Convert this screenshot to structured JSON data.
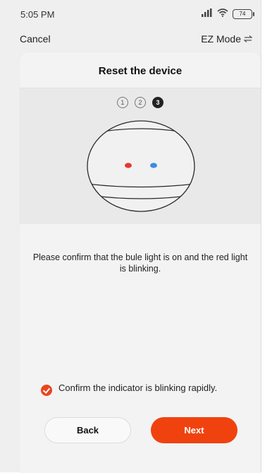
{
  "status_bar": {
    "time": "5:05 PM",
    "battery": "74"
  },
  "nav": {
    "cancel_label": "Cancel",
    "mode_label": "EZ Mode",
    "mode_icon": "swap-arrows-icon"
  },
  "card": {
    "title": "Reset the device"
  },
  "steps": {
    "items": [
      "1",
      "2",
      "3"
    ],
    "active": 3
  },
  "instruction": "Please confirm that the bule light is on and the red light is blinking.",
  "confirm": {
    "label": "Confirm the indicator is blinking rapidly.",
    "checked": true
  },
  "buttons": {
    "back_label": "Back",
    "next_label": "Next"
  },
  "colors": {
    "accent": "#f0420f",
    "red_light": "#e8362f",
    "blue_light": "#3d8be3"
  }
}
